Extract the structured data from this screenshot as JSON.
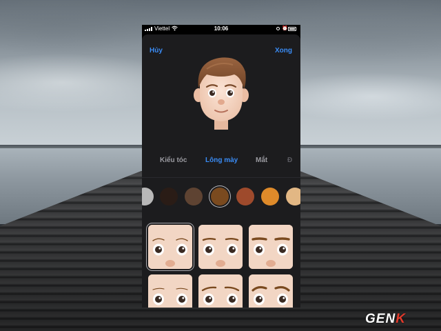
{
  "status_bar": {
    "carrier": "Viettel",
    "time": "10:06",
    "icons": [
      "signal-icon",
      "wifi-icon",
      "orientation-lock-icon",
      "alarm-icon",
      "battery-icon"
    ]
  },
  "nav": {
    "cancel_label": "Hủy",
    "done_label": "Xong",
    "accent_color": "#3a8cf5"
  },
  "tabs": [
    {
      "label": "Kiểu tóc",
      "selected": false
    },
    {
      "label": "Lông mày",
      "selected": true
    },
    {
      "label": "Mắt",
      "selected": false
    },
    {
      "label": "Đ",
      "selected": false
    }
  ],
  "color_swatches": [
    {
      "color": "#b8b8b8",
      "selected": false
    },
    {
      "color": "#2a1c16",
      "selected": false
    },
    {
      "color": "#5e4332",
      "selected": false
    },
    {
      "color": "#7a4a1f",
      "selected": true
    },
    {
      "color": "#9e4a2c",
      "selected": false
    },
    {
      "color": "#de8a2a",
      "selected": false
    },
    {
      "color": "#e2b784",
      "selected": false
    }
  ],
  "eyebrow_styles": [
    {
      "style": "thin-arched",
      "selected": true
    },
    {
      "style": "soft-straight",
      "selected": false
    },
    {
      "style": "thick-straight",
      "selected": false
    },
    {
      "style": "faint",
      "selected": false
    },
    {
      "style": "angled",
      "selected": false
    },
    {
      "style": "bold-arched",
      "selected": false
    }
  ],
  "watermark": {
    "text_main": "GEN",
    "text_accent": "K"
  }
}
